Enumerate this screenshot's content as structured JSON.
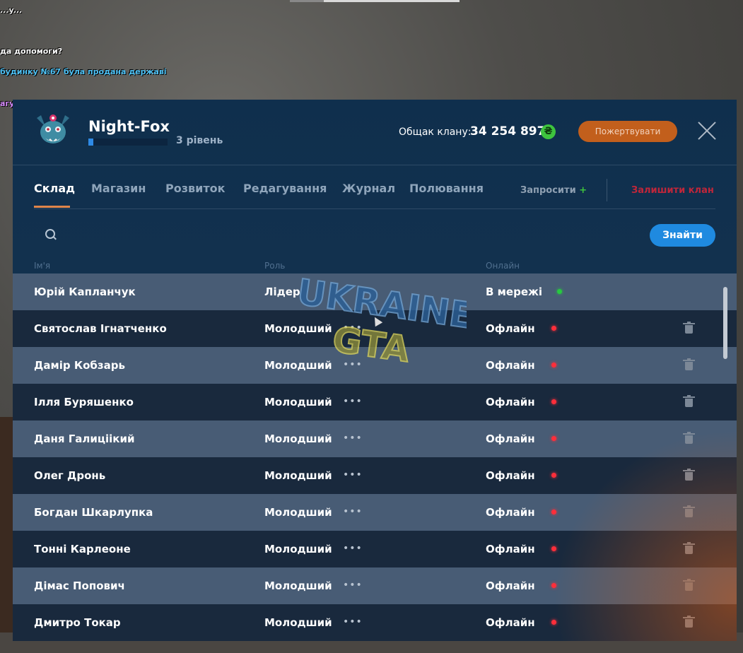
{
  "chat": {
    "line1": "...y...",
    "line2": "да допомоги?",
    "line3": "будинку №67 була продана державі",
    "line4": "агун"
  },
  "header": {
    "clan_name": "Night-Fox",
    "level_text": "3 рівень",
    "level_progress": 0.06,
    "fund_label": "Общак клану:",
    "fund_value": "34 254 897",
    "currency_symbol": "₴",
    "donate_label": "Пожертвувати"
  },
  "tabs": {
    "items": [
      {
        "label": "Склад",
        "active": true
      },
      {
        "label": "Магазин",
        "active": false
      },
      {
        "label": "Розвиток",
        "active": false
      },
      {
        "label": "Редагування",
        "active": false
      },
      {
        "label": "Журнал",
        "active": false
      },
      {
        "label": "Полювання",
        "active": false
      }
    ],
    "invite_label": "Запросити",
    "invite_plus": "+",
    "leave_label": "Залишити клан"
  },
  "search": {
    "placeholder": "",
    "button_label": "Знайти"
  },
  "columns": {
    "name": "Ім'я",
    "role": "Роль",
    "status": "Онлайн"
  },
  "members": [
    {
      "name": "Юрій Капланчук",
      "role": "Лідер",
      "status": "В мережі",
      "online": true
    },
    {
      "name": "Святослав Ігнатченко",
      "role": "Молодший",
      "status": "Офлайн",
      "online": false
    },
    {
      "name": "Дамір Кобзарь",
      "role": "Молодший",
      "status": "Офлайн",
      "online": false
    },
    {
      "name": "Ілля Буряшенко",
      "role": "Молодший",
      "status": "Офлайн",
      "online": false
    },
    {
      "name": "Даня Галиціікий",
      "role": "Молодший",
      "status": "Офлайн",
      "online": false
    },
    {
      "name": "Олег Дронь",
      "role": "Молодший",
      "status": "Офлайн",
      "online": false
    },
    {
      "name": "Богдан Шкарлупка",
      "role": "Молодший",
      "status": "Офлайн",
      "online": false
    },
    {
      "name": "Тонні Карлеоне",
      "role": "Молодший",
      "status": "Офлайн",
      "online": false
    },
    {
      "name": "Дімас Попович",
      "role": "Молодший",
      "status": "Офлайн",
      "online": false
    },
    {
      "name": "Дмитро Токар",
      "role": "Молодший",
      "status": "Офлайн",
      "online": false
    }
  ],
  "row_menu_glyph": "•••",
  "watermark": {
    "line1": "UKRAINE",
    "line2": "GTA"
  },
  "colors": {
    "panel_bg": "#12314e",
    "accent_blue": "#1f8ae0",
    "donate_orange": "#c25f1c",
    "leave_red": "#c0263a",
    "online_green": "#27c93f",
    "offline_red": "#ff2e3a",
    "tab_underline": "#e0854a"
  }
}
